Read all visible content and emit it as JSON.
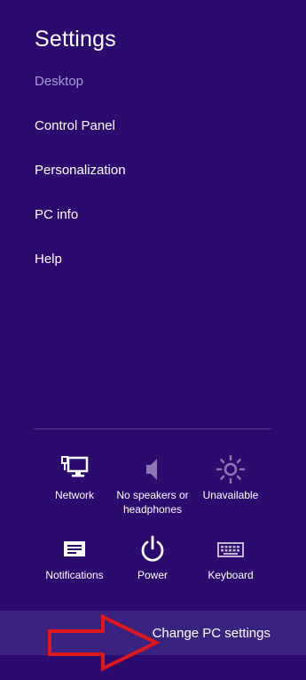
{
  "header": {
    "title": "Settings",
    "subtitle": "Desktop"
  },
  "menu": {
    "items": [
      {
        "label": "Control Panel"
      },
      {
        "label": "Personalization"
      },
      {
        "label": "PC info"
      },
      {
        "label": "Help"
      }
    ]
  },
  "quick_settings": {
    "network": {
      "label": "Network",
      "icon": "network-icon"
    },
    "volume": {
      "label_line1": "No speakers or",
      "label_line2": "headphones",
      "icon": "speaker-icon"
    },
    "brightness": {
      "label": "Unavailable",
      "icon": "brightness-icon"
    },
    "notifications": {
      "label": "Notifications",
      "icon": "notifications-icon"
    },
    "power": {
      "label": "Power",
      "icon": "power-icon"
    },
    "keyboard": {
      "label": "Keyboard",
      "icon": "keyboard-icon"
    }
  },
  "footer": {
    "change_pc_settings": "Change PC settings"
  },
  "colors": {
    "background": "#2b0b6e",
    "footer_bar": "#3a2380",
    "annotation_arrow": "#e01818"
  }
}
